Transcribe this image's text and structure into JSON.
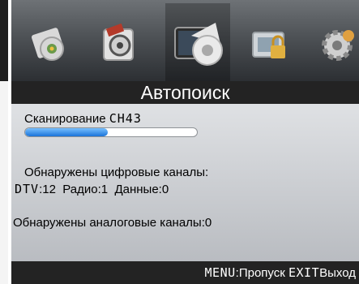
{
  "menu": {
    "icons": [
      "picture-icon",
      "sound-icon",
      "channel-icon",
      "lock-icon",
      "setup-icon"
    ],
    "selected_index": 2
  },
  "title": "Автопоиск",
  "scan": {
    "label": "Сканирование",
    "channel": "CH43",
    "progress_percent": 48
  },
  "digital": {
    "heading": "Обнаружены цифровые каналы:",
    "dtv_label": "DTV",
    "dtv_value": ":12",
    "radio": "Радио:1",
    "data": "Данные:0"
  },
  "analog": {
    "text": "Обнаружены аналоговые каналы:0"
  },
  "footer": {
    "menu_key": "MENU",
    "menu_action": ":Пропуск",
    "exit_key": "EXIT",
    "exit_action": "Выход"
  },
  "colors": {
    "header_bar": "#232323",
    "progress_fill": "#1a73d8",
    "panel_bg": "#dfe1e4"
  }
}
